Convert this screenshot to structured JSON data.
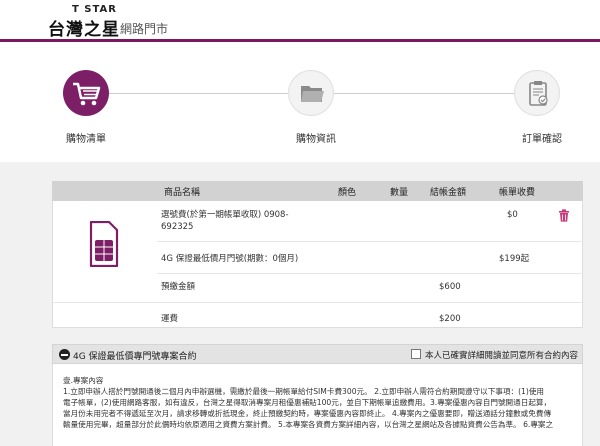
{
  "header": {
    "brand_en": "T STAR",
    "brand_zh": "台灣之星",
    "subtitle": "網路門市",
    "accent": "#7a1a5e"
  },
  "steps": [
    {
      "label": "購物清單",
      "icon": "cart-icon",
      "active": true
    },
    {
      "label": "購物資訊",
      "icon": "folder-icon",
      "active": false
    },
    {
      "label": "訂單確認",
      "icon": "clipboard-check-icon",
      "active": false
    }
  ],
  "table": {
    "headers": {
      "product": "商品名稱",
      "color": "顏色",
      "qty": "數量",
      "checkout": "結帳金額",
      "monthly": "帳單收費"
    },
    "item1": {
      "name_line1": "選號費(於第一期帳單收取) 0908-",
      "name_line2": "692325",
      "monthly": "$0"
    },
    "item2": {
      "name": "4G 保證最低價月門號(期數：0個月)",
      "monthly": "$199起"
    },
    "prepay": {
      "label": "預繳金額",
      "checkout": "$600"
    },
    "shipping": {
      "label": "運費",
      "checkout": "$200"
    }
  },
  "contract": {
    "title": "4G 保證最低價專門號專案合約",
    "agree_label": "本人已確實詳細閱讀並同意所有合約內容",
    "lines": [
      "壹.專案內容",
      "1.立即申辦人搭於門號開通後二個月內申辦選機，需繳於最後一期帳單給付SIM卡費300元。 2.立即申辦人需符合約期間遵守以下事項：(1)使用",
      "電子帳單，(2)使用網路客服，如有違反，台灣之星得取消專案月租優惠補貼100元，並自下期帳單追繳費用。3.專案優惠內容自門號開通日起算，",
      "當月份未用完者不得遞延至次月，請求移轉或折抵現金，終止預繳契約時，專案優惠內容即終止。 4.專案內之優惠要即，贈送通話分鐘數或免費傳",
      "輸量使用完畢，超量部分於此價時均依原適用之資費方案計費。 5.本專案各資費方案詳細內容，以台灣之星網站及各據點資費公告為準。 6.專案之"
    ]
  }
}
